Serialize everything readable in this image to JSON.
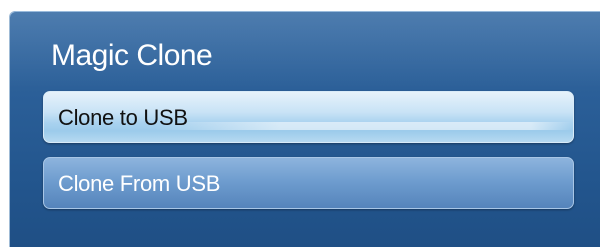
{
  "menu": {
    "title": "Magic Clone",
    "items": [
      {
        "label": "Clone to USB",
        "selected": true
      },
      {
        "label": "Clone From USB",
        "selected": false
      }
    ]
  },
  "colors": {
    "panel_background": "#2b5f98",
    "selected_item": "#b6d9f1",
    "normal_item": "#6f9dcf",
    "title_text": "#ffffff"
  }
}
